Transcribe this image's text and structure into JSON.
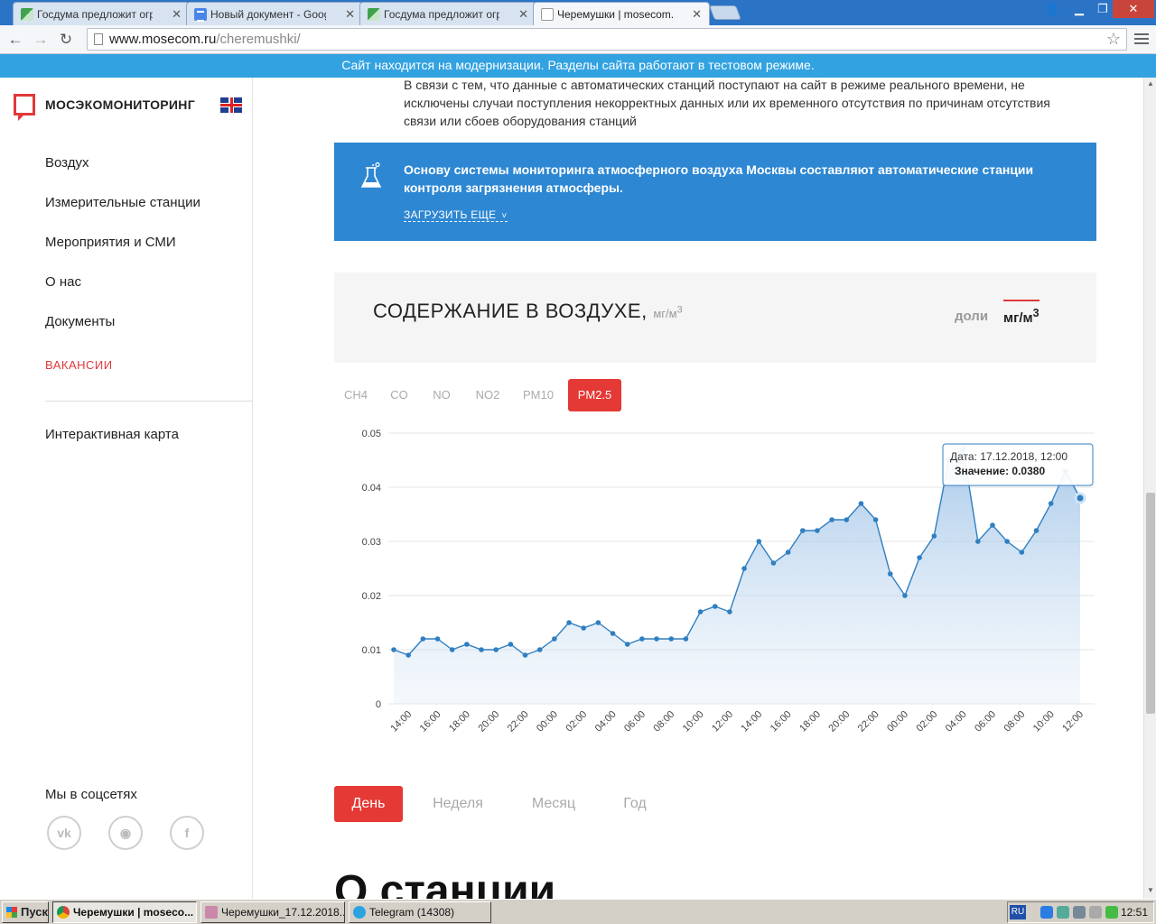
{
  "browser": {
    "tabs": [
      {
        "title": "Госдума предложит огран"
      },
      {
        "title": "Новый документ - Google Д"
      },
      {
        "title": "Госдума предложит огран"
      },
      {
        "title": "Черемушки | mosecom.ru"
      }
    ],
    "url_host": "www.mosecom.ru",
    "url_path": "/cheremushki/"
  },
  "banner": {
    "text": "Сайт находится на модернизации. Разделы сайта работают в тестовом режиме."
  },
  "sidebar": {
    "logo": "МОСЭКОМОНИТОРИНГ",
    "items": [
      "Воздух",
      "Измерительные станции",
      "Мероприятия и СМИ",
      "О нас",
      "Документы",
      "ВАКАНСИИ"
    ],
    "map_link": "Интерактивная карта",
    "social_title": "Мы в соцсетях",
    "social_icons": [
      "vk-icon",
      "odnoklassniki-icon",
      "facebook-icon"
    ]
  },
  "main": {
    "intro": "В связи с тем, что данные с автоматических станций поступают на сайт в режиме реального времени, не исключены случаи поступления некорректных данных или их временного отсутствия по причинам отсутствия связи или сбоев оборудования станций",
    "info": {
      "text": "Основу системы мониторинга атмосферного воздуха Москвы составляют автоматические станции контроля загрязнения атмосферы.",
      "load_more": "ЗАГРУЗИТЬ ЕЩЕ",
      "icon": "flask-icon"
    },
    "content": {
      "title": "СОДЕРЖАНИЕ В ВОЗДУХЕ,",
      "unit": "мг/м",
      "unit_sup": "3",
      "switch_off": "доли",
      "switch_on": "мг/м",
      "switch_on_sup": "3"
    },
    "pollutant_tabs": [
      "CH4",
      "CO",
      "NO",
      "NO2",
      "PM10",
      "PM2.5"
    ],
    "active_pollutant": "PM2.5",
    "periods": [
      "День",
      "Неделя",
      "Месяц",
      "Год"
    ],
    "active_period": "День",
    "station_heading": "О станции"
  },
  "chart_data": {
    "type": "area",
    "title": "",
    "xlabel": "",
    "ylabel": "",
    "ylim": [
      0,
      0.05
    ],
    "y_ticks": [
      0,
      0.01,
      0.02,
      0.03,
      0.04,
      0.05
    ],
    "x_tick_labels": [
      "14:00",
      "16:00",
      "18:00",
      "20:00",
      "22:00",
      "00:00",
      "02:00",
      "04:00",
      "06:00",
      "08:00",
      "10:00",
      "12:00",
      "14:00",
      "16:00",
      "18:00",
      "20:00",
      "22:00",
      "00:00",
      "02:00",
      "04:00",
      "06:00",
      "08:00",
      "10:00",
      "12:00"
    ],
    "series": [
      {
        "values": [
          0.01,
          0.009,
          0.012,
          0.012,
          0.01,
          0.011,
          0.01,
          0.01,
          0.011,
          0.009,
          0.01,
          0.012,
          0.015,
          0.014,
          0.015,
          0.013,
          0.011,
          0.012,
          0.012,
          0.012,
          0.012,
          0.017,
          0.018,
          0.017,
          0.025,
          0.03,
          0.026,
          0.028,
          0.032,
          0.032,
          0.034,
          0.034,
          0.037,
          0.034,
          0.024,
          0.02,
          0.027,
          0.031,
          0.045,
          0.047,
          0.03,
          0.033,
          0.03,
          0.028,
          0.032,
          0.037,
          0.043,
          0.038
        ]
      }
    ],
    "grid": true,
    "color": "#2f7fc1",
    "tooltip": {
      "date_label": "Дата:",
      "date_value": "17.12.2018, 12:00",
      "value_label": "Значение:",
      "value": "0.0380"
    }
  },
  "taskbar": {
    "start": "Пуск",
    "items": [
      "Черемушки | mosecо...",
      "Черемушки_17.12.2018...",
      "Telegram (14308)"
    ],
    "lang": "RU",
    "clock": "12:51"
  }
}
